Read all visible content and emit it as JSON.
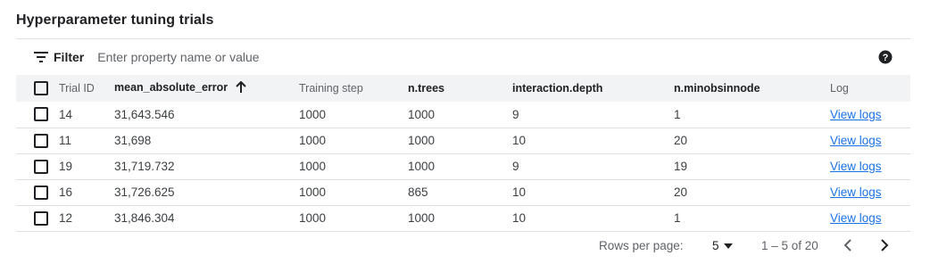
{
  "page": {
    "title": "Hyperparameter tuning trials"
  },
  "filter": {
    "label": "Filter",
    "placeholder": "Enter property name or value",
    "icon": "filter-list-icon"
  },
  "help": {
    "icon": "help-icon"
  },
  "table": {
    "columns": {
      "trial_id": "Trial ID",
      "mae": "mean_absolute_error",
      "training_step": "Training step",
      "n_trees": "n.trees",
      "interaction_depth": "interaction.depth",
      "n_minobsinnode": "n.minobsinnode",
      "log": "Log"
    },
    "sort": {
      "column": "mean_absolute_error",
      "direction": "ascending",
      "icon": "arrow-upward-icon"
    },
    "rows": [
      {
        "trial_id": "14",
        "mae": "31,643.546",
        "training_step": "1000",
        "n_trees": "1000",
        "interaction_depth": "9",
        "n_minobsinnode": "1",
        "log": "View logs"
      },
      {
        "trial_id": "11",
        "mae": "31,698",
        "training_step": "1000",
        "n_trees": "1000",
        "interaction_depth": "10",
        "n_minobsinnode": "20",
        "log": "View logs"
      },
      {
        "trial_id": "19",
        "mae": "31,719.732",
        "training_step": "1000",
        "n_trees": "1000",
        "interaction_depth": "9",
        "n_minobsinnode": "19",
        "log": "View logs"
      },
      {
        "trial_id": "16",
        "mae": "31,726.625",
        "training_step": "1000",
        "n_trees": "865",
        "interaction_depth": "10",
        "n_minobsinnode": "20",
        "log": "View logs"
      },
      {
        "trial_id": "12",
        "mae": "31,846.304",
        "training_step": "1000",
        "n_trees": "1000",
        "interaction_depth": "10",
        "n_minobsinnode": "1",
        "log": "View logs"
      }
    ]
  },
  "pagination": {
    "rows_per_page_label": "Rows per page:",
    "rows_per_page_value": "5",
    "range_text": "1 – 5 of 20",
    "prev_icon": "chevron-left-icon",
    "next_icon": "chevron-right-icon"
  },
  "colors": {
    "link": "#1a73e8",
    "header_bg": "#f1f3f4",
    "divider": "#e0e0e0",
    "text": "#202124",
    "muted_text": "#5f6368"
  }
}
